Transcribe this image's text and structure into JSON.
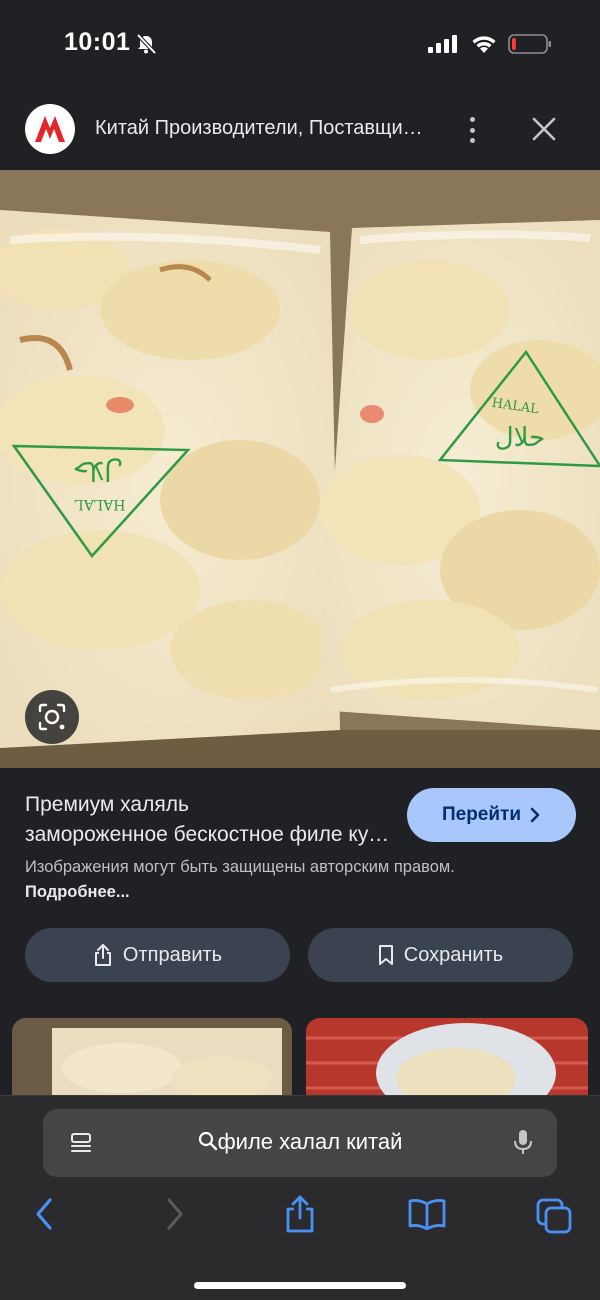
{
  "status": {
    "time": "10:01",
    "battery_level": 0.12,
    "battery_color": "#ff3b30"
  },
  "tab": {
    "title": "Китай Производители, Поставщики, Фабрика - Оптовая продажа"
  },
  "image": {
    "stamp_left_text": "HALAL",
    "stamp_left_arabic": "حلال",
    "stamp_right_text": "HALAL",
    "stamp_right_arabic": "حلال"
  },
  "result": {
    "title_line1": "Премиум халяль",
    "title_line2": "замороженное бескостное филе курицы",
    "visit_label": "Перейти",
    "copyright_text": "Изображения могут быть защищены авторским правом.",
    "more_link": "Подробнее...",
    "share_label": "Отправить",
    "save_label": "Сохранить"
  },
  "browser": {
    "search_query": "филе халал китай"
  },
  "colors": {
    "accent": "#a8c7fa",
    "background": "#202124",
    "button": "#3c4350"
  }
}
